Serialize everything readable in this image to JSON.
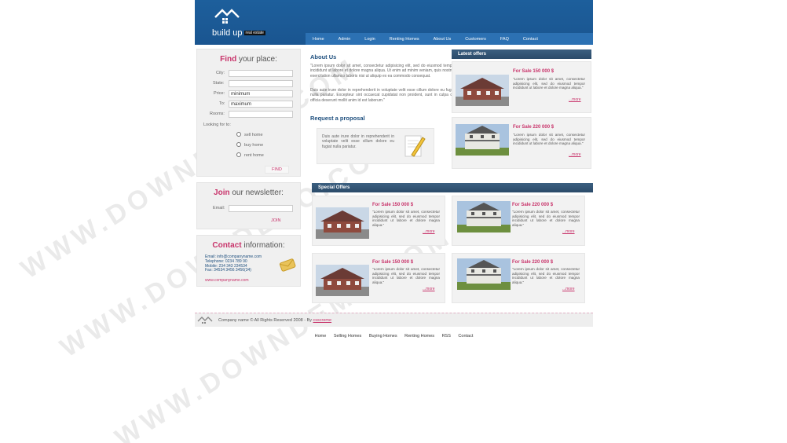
{
  "logo": {
    "brand": "build up",
    "tagline": "real estate"
  },
  "nav": [
    "Home",
    "Admin",
    "Login",
    "Renting Homes",
    "About Us",
    "Customers",
    "FAQ",
    "Contact"
  ],
  "find": {
    "title_hl": "Find",
    "title_rest": " your place:",
    "fields": [
      "City:",
      "State:",
      "Price:",
      "To:",
      "Rooms:"
    ],
    "price_value": "minimum",
    "to_value": "maximum",
    "looking": "Looking for to:",
    "options": [
      "sell home",
      "buy home",
      "rent home"
    ],
    "button": "FIND"
  },
  "newsletter": {
    "title_hl": "Join",
    "title_rest": " our newsletter:",
    "label": "Email:",
    "button": "JOIN"
  },
  "contact": {
    "title_hl": "Contact",
    "title_rest": " information:",
    "lines": [
      "Email: info@companyname.com",
      "Telephone: 0234 789 90",
      "Mobile: 234 343 234534",
      "Fax: 34534 3456 3456(34)"
    ],
    "site": "www.companyname.com"
  },
  "about": {
    "title": "About Us",
    "p1": "\"Lorem ipsum dolor sit amet, consectetur adipisicing elit, sed do eiusmod tempor incididunt ut labore et dolore magna aliqua. Ut enim ad minim veniam, quis nostrud exercitation ullamco laboris nisi ut aliquip ex ea commodo consequat.",
    "p2": "Duis aute irure dolor in reprehenderit in voluptate velit esse cillum dolore eu fugiat nulla pariatur. Excepteur sint occaecat cupidatat non proident, sunt in culpa qui officia deserunt mollit anim id est laborum.\""
  },
  "request": {
    "title": "Request a proposal",
    "text": "Duis aute irure dolor in reprehenderit in voluptate velit esse cillum dolore eu fugiat nulla pariatur."
  },
  "latest": {
    "title": "Latest offers",
    "items": [
      {
        "price": "For Sale 150 000 $",
        "text": "\"Lorem ipsum dolor sit amet, consectetur adipisicing elit, sed do eiusmod tempor incididunt ut labore et dolore magna aliqua.\"",
        "more": "...more"
      },
      {
        "price": "For Sale 220 000 $",
        "text": "\"Lorem ipsum dolor sit amet, consectetur adipisicing elit, sed do eiusmod tempor incididunt ut labore et dolore magna aliqua.\"",
        "more": "...more"
      }
    ]
  },
  "special": {
    "title": "Special Offers",
    "items": [
      {
        "price": "For Sale 150 000 $",
        "text": "\"Lorem ipsum dolor sit amet, consectetur adipisicing elit, sed do eiusmod tempor incididunt ut labore et dolore magna aliqua.\"",
        "more": "...more"
      },
      {
        "price": "For Sale 220 000 $",
        "text": "\"Lorem ipsum dolor sit amet, consectetur adipisicing elit, sed do eiusmod tempor incididunt ut labore et dolore magna aliqua.\"",
        "more": "...more"
      },
      {
        "price": "For Sale 150 000 $",
        "text": "\"Lorem ipsum dolor sit amet, consectetur adipisicing elit, sed do eiusmod tempor incididunt ut labore et dolore magna aliqua.\"",
        "more": "...more"
      },
      {
        "price": "For Sale 220 000 $",
        "text": "\"Lorem ipsum dolor sit amet, consectetur adipisicing elit, sed do eiusmod tempor incididunt ut labore et dolore magna aliqua.\"",
        "more": "...more"
      }
    ]
  },
  "footer": {
    "copy": "Company name © All Rights Reserved 2008 - By ",
    "credit": "csscreme"
  },
  "footer_nav": [
    "Home",
    "Selling Homes",
    "Buying Homes",
    "Renting Homes",
    "RSS",
    "Contact"
  ],
  "watermark": "WWW.DOWNDEMO.COM",
  "colors": {
    "header": "#1d5f9c",
    "accent": "#c8336a",
    "bar": "#2f506f"
  }
}
